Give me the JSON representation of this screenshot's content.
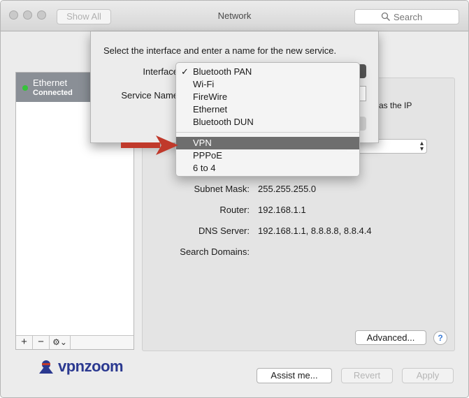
{
  "window": {
    "title": "Network",
    "show_all_label": "Show All",
    "search_placeholder": "Search"
  },
  "sidebar": {
    "services": [
      {
        "name": "Ethernet",
        "status": "Connected",
        "status_color": "#35c33a"
      }
    ],
    "tools": {
      "add": "+",
      "remove": "−",
      "gear": "⚙⌄"
    }
  },
  "detail": {
    "ip_hint": "as the IP",
    "fields": [
      {
        "label": "Subnet Mask:",
        "value": "255.255.255.0"
      },
      {
        "label": "Router:",
        "value": "192.168.1.1"
      },
      {
        "label": "DNS Server:",
        "value": "192.168.1.1, 8.8.8.8, 8.8.4.4"
      },
      {
        "label": "Search Domains:",
        "value": ""
      }
    ],
    "advanced_label": "Advanced...",
    "help_label": "?"
  },
  "sheet": {
    "prompt": "Select the interface and enter a name for the new service.",
    "interface_label": "Interface",
    "service_name_label": "Service Name"
  },
  "interface_menu": {
    "checked_item": "Bluetooth PAN",
    "selected_item": "VPN",
    "group1": [
      "Bluetooth PAN",
      "Wi-Fi",
      "FireWire",
      "Ethernet",
      "Bluetooth DUN"
    ],
    "group2": [
      "VPN",
      "PPPoE",
      "6 to 4"
    ]
  },
  "footer": {
    "assist_label": "Assist me...",
    "revert_label": "Revert",
    "apply_label": "Apply"
  },
  "logo": {
    "part1": "vpn",
    "part2": "zoom"
  },
  "colors": {
    "arrow": "#c0392b",
    "menu_highlight": "#6e6e6e",
    "logo": "#2b3990"
  }
}
